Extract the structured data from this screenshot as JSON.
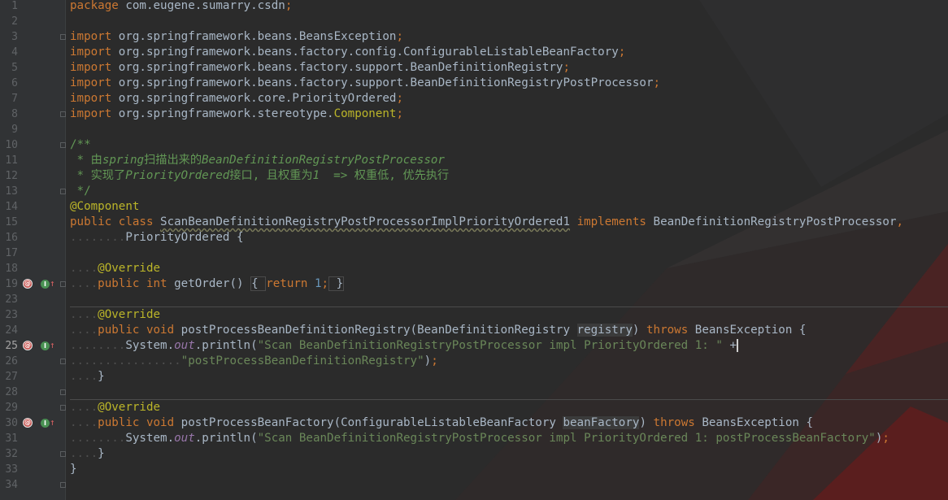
{
  "editor": {
    "current_line": 25,
    "lines": [
      {
        "n": "1",
        "t": [
          [
            "kw",
            "package "
          ],
          [
            "",
            "com.eugene.sumarry.csdn"
          ],
          [
            "kw",
            ";"
          ]
        ]
      },
      {
        "n": "2",
        "t": []
      },
      {
        "n": "3",
        "t": [
          [
            "kw",
            "import "
          ],
          [
            "",
            "org.springframework.beans.BeansException"
          ],
          [
            "kw",
            ";"
          ]
        ]
      },
      {
        "n": "4",
        "t": [
          [
            "kw",
            "import "
          ],
          [
            "",
            "org.springframework.beans.factory.config.ConfigurableListableBeanFactory"
          ],
          [
            "kw",
            ";"
          ]
        ]
      },
      {
        "n": "5",
        "t": [
          [
            "kw",
            "import "
          ],
          [
            "",
            "org.springframework.beans.factory.support.BeanDefinitionRegistry"
          ],
          [
            "kw",
            ";"
          ]
        ]
      },
      {
        "n": "6",
        "t": [
          [
            "kw",
            "import "
          ],
          [
            "",
            "org.springframework.beans.factory.support.BeanDefinitionRegistryPostProcessor"
          ],
          [
            "kw",
            ";"
          ]
        ]
      },
      {
        "n": "7",
        "t": [
          [
            "kw",
            "import "
          ],
          [
            "",
            "org.springframework.core.PriorityOrdered"
          ],
          [
            "kw",
            ";"
          ]
        ]
      },
      {
        "n": "8",
        "t": [
          [
            "kw",
            "import "
          ],
          [
            "",
            "org.springframework.stereotype."
          ],
          [
            "ann",
            "Component"
          ],
          [
            "kw",
            ";"
          ]
        ]
      },
      {
        "n": "9",
        "t": []
      },
      {
        "n": "10",
        "t": [
          [
            "docc",
            "/**"
          ]
        ]
      },
      {
        "n": "11",
        "t": [
          [
            "docc",
            " * 由"
          ],
          [
            "doc",
            "spring"
          ],
          [
            "docc",
            "扫描出来的"
          ],
          [
            "doc",
            "BeanDefinitionRegistryPostProcessor"
          ]
        ]
      },
      {
        "n": "12",
        "t": [
          [
            "docc",
            " * 实现了"
          ],
          [
            "doc",
            "PriorityOrdered"
          ],
          [
            "docc",
            "接口, 且权重为"
          ],
          [
            "doc",
            "1"
          ],
          [
            "docc",
            "  => 权重低, 优先执行"
          ]
        ]
      },
      {
        "n": "13",
        "t": [
          [
            "docc",
            " */"
          ]
        ]
      },
      {
        "n": "14",
        "t": [
          [
            "ann",
            "@Component"
          ]
        ]
      },
      {
        "n": "15",
        "t": [
          [
            "kw",
            "public class "
          ],
          [
            "typo",
            "ScanBeanDefinitionRegistryPostProcessorImplPriorityOrdered1"
          ],
          [
            "",
            " "
          ],
          [
            "kw",
            "implements "
          ],
          [
            "",
            "BeanDefinitionRegistryPostProcessor"
          ],
          [
            "kw",
            ","
          ]
        ]
      },
      {
        "n": "16",
        "t": [
          [
            "dot",
            "........"
          ],
          [
            "",
            "PriorityOrdered {"
          ]
        ]
      },
      {
        "n": "17",
        "t": []
      },
      {
        "n": "18",
        "t": [
          [
            "dot",
            "...."
          ],
          [
            "ann",
            "@Override"
          ]
        ]
      },
      {
        "n": "19",
        "t": [
          [
            "dot",
            "...."
          ],
          [
            "kw",
            "public int "
          ],
          [
            "",
            "getOrder() "
          ],
          [
            "fb",
            "{ "
          ],
          [
            "kw",
            "return "
          ],
          [
            "num",
            "1"
          ],
          [
            "kw",
            ";"
          ],
          [
            "fb",
            " }"
          ]
        ]
      },
      {
        "n": "23",
        "t": []
      },
      {
        "n": "23",
        "t": [
          [
            "dot",
            "...."
          ],
          [
            "ann",
            "@Override"
          ]
        ]
      },
      {
        "n": "24",
        "t": [
          [
            "dot",
            "...."
          ],
          [
            "kw",
            "public void "
          ],
          [
            "",
            "postProcessBeanDefinitionRegistry(BeanDefinitionRegistry "
          ],
          [
            "hl",
            "registry"
          ],
          [
            "",
            ") "
          ],
          [
            "kw",
            "throws "
          ],
          [
            "",
            "BeansException {"
          ]
        ]
      },
      {
        "n": "25",
        "t": [
          [
            "dot",
            "........"
          ],
          [
            "",
            "System."
          ],
          [
            "st",
            "out"
          ],
          [
            "",
            ".println("
          ],
          [
            "str",
            "\"Scan BeanDefinitionRegistryPostProcessor impl PriorityOrdered 1: \""
          ],
          [
            "",
            " +"
          ],
          [
            "caret",
            ""
          ]
        ]
      },
      {
        "n": "26",
        "t": [
          [
            "dot",
            "................"
          ],
          [
            "str",
            "\"postProcessBeanDefinitionRegistry\""
          ],
          [
            "",
            ")"
          ],
          [
            "kw",
            ";"
          ]
        ]
      },
      {
        "n": "27",
        "t": [
          [
            "dot",
            "...."
          ],
          [
            "",
            "}"
          ]
        ]
      },
      {
        "n": "28",
        "t": []
      },
      {
        "n": "29",
        "t": [
          [
            "dot",
            "...."
          ],
          [
            "ann",
            "@Override"
          ]
        ]
      },
      {
        "n": "30",
        "t": [
          [
            "dot",
            "...."
          ],
          [
            "kw",
            "public void "
          ],
          [
            "",
            "postProcessBeanFactory(ConfigurableListableBeanFactory "
          ],
          [
            "hl",
            "beanFactory"
          ],
          [
            "",
            ") "
          ],
          [
            "kw",
            "throws "
          ],
          [
            "",
            "BeansException {"
          ]
        ]
      },
      {
        "n": "31",
        "t": [
          [
            "dot",
            "........"
          ],
          [
            "",
            "System."
          ],
          [
            "st",
            "out"
          ],
          [
            "",
            ".println("
          ],
          [
            "str",
            "\"Scan BeanDefinitionRegistryPostProcessor impl PriorityOrdered 1: postProcessBeanFactory\""
          ],
          [
            "",
            ")"
          ],
          [
            "kw",
            ";"
          ]
        ]
      },
      {
        "n": "32",
        "t": [
          [
            "dot",
            "...."
          ],
          [
            "",
            "}"
          ]
        ]
      },
      {
        "n": "33",
        "t": [
          [
            "",
            "}"
          ]
        ]
      },
      {
        "n": "34",
        "t": []
      }
    ]
  }
}
